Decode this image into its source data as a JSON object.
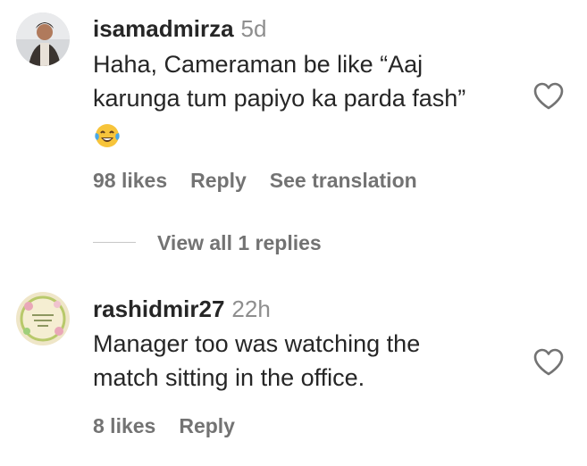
{
  "comments": [
    {
      "username": "isamadmirza",
      "time": "5d",
      "lines": [
        "Haha, Cameraman be like “Aaj",
        "karunga tum papiyo ka parda fash”"
      ],
      "emoji": "face-with-tears-of-joy",
      "likes": "98 likes",
      "reply": "Reply",
      "translation": "See translation"
    },
    {
      "username": "rashidmir27",
      "time": "22h",
      "lines": [
        "Manager too was watching the",
        "match sitting in the office."
      ],
      "likes": "8 likes",
      "reply": "Reply"
    }
  ],
  "view_replies": "View all 1 replies",
  "colors": {
    "text": "#262626",
    "muted": "#737373",
    "timestamp": "#8e8e8e",
    "divider": "#c7c7c7"
  },
  "icons": [
    "heart-icon",
    "face-with-tears-of-joy-emoji"
  ]
}
